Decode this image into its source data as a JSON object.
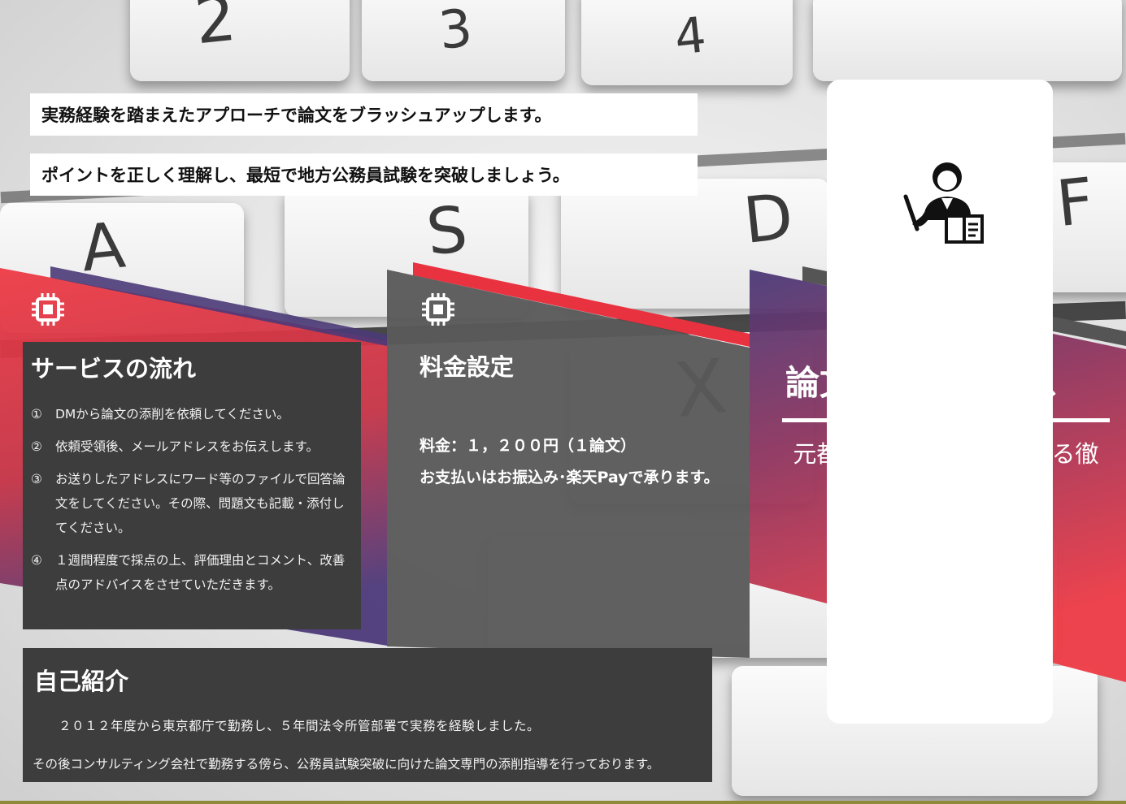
{
  "headlines": [
    "実務経験を踏まえたアプローチで論文をブラッシュアップします。",
    "ポイントを正しく理解し、最短で地方公務員試験を突破しましょう。"
  ],
  "keyboard": {
    "keys": [
      "2",
      "3",
      "4",
      "A",
      "S",
      "D",
      "F",
      "X"
    ]
  },
  "flow": {
    "title": "サービスの流れ",
    "items": [
      {
        "num": "①",
        "text": "DMから論文の添削を依頼してください。"
      },
      {
        "num": "②",
        "text": "依頼受領後、メールアドレスをお伝えします。"
      },
      {
        "num": "③",
        "text": "お送りしたアドレスにワード等のファイルで回答論文をしてください。その際、問題文も記載・添付してください。"
      },
      {
        "num": "④",
        "text": "１週間程度で採点の上、評価理由とコメント、改善点のアドバイスをさせていただきます。"
      }
    ]
  },
  "pricing": {
    "title": "料金設定",
    "line1": "料金：１，２００円（１論文）",
    "line2": "お支払いはお振込み･楽天Payで承ります。"
  },
  "intro": {
    "title": "自己紹介",
    "line1": "２０１２年度から東京都庁で勤務し、５年間法令所管部署で実務を経験しました。",
    "line2": "その後コンサルティング会社で勤務する傍ら、公務員試験突破に向けた論文専門の添削指導を行っております。"
  },
  "service": {
    "title": "論文添削サービス",
    "subtitle": "元都庁職員法規担当による徹底添削"
  },
  "icons": {
    "section": "chip-icon",
    "hero": "teacher-icon"
  },
  "colors": {
    "red": "#e8323f",
    "purple": "#4b3a78",
    "dark_panel": "#3d3d3d",
    "gray_panel": "#595959",
    "white": "#ffffff"
  }
}
